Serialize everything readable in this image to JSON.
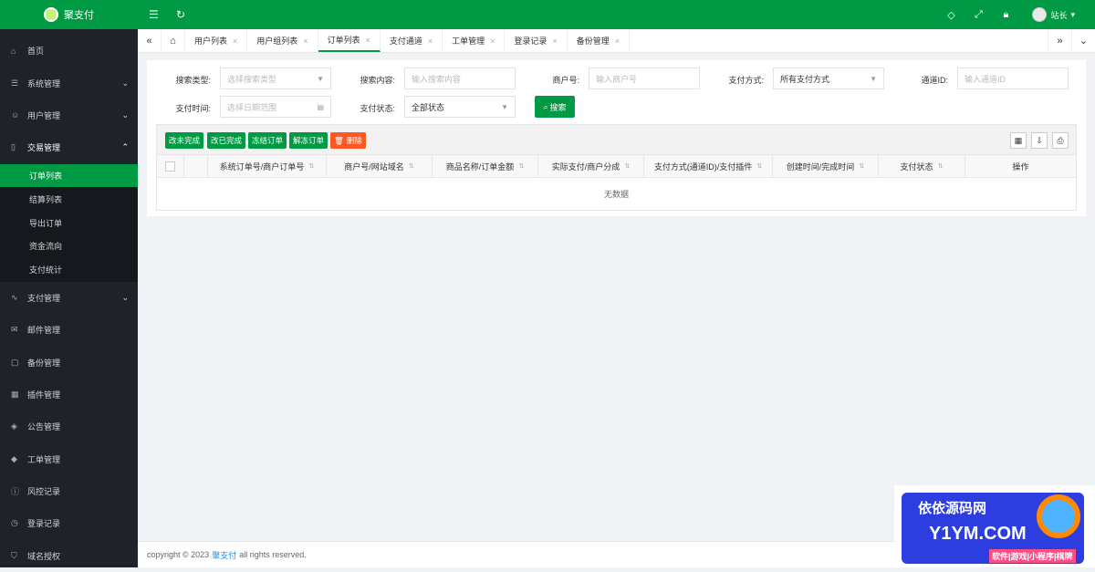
{
  "app": {
    "name": "聚支付",
    "user": "站长"
  },
  "topbar": {
    "collapse_icon": "menu-fold-icon",
    "refresh_icon": "refresh-icon",
    "right_icons": [
      "tag-icon",
      "fullscreen-icon",
      "lock-icon"
    ]
  },
  "sidebar": {
    "items": [
      {
        "label": "首页",
        "icon": "home-icon"
      },
      {
        "label": "系统管理",
        "icon": "sliders-icon"
      },
      {
        "label": "用户管理",
        "icon": "user-icon"
      },
      {
        "label": "交易管理",
        "icon": "document-icon"
      },
      {
        "label": "支付管理",
        "icon": "pulse-icon"
      },
      {
        "label": "邮件管理",
        "icon": "mail-icon"
      },
      {
        "label": "备份管理",
        "icon": "note-icon"
      },
      {
        "label": "插件管理",
        "icon": "grid-icon"
      },
      {
        "label": "公告管理",
        "icon": "megaphone-icon"
      },
      {
        "label": "工单管理",
        "icon": "ticket-icon"
      },
      {
        "label": "风控记录",
        "icon": "info-icon"
      },
      {
        "label": "登录记录",
        "icon": "clock-icon"
      },
      {
        "label": "域名授权",
        "icon": "shield-icon"
      }
    ],
    "sub_items": [
      "订单列表",
      "结算列表",
      "导出订单",
      "资金流向",
      "支付统计"
    ]
  },
  "tabs": [
    "用户列表",
    "用户组列表",
    "订单列表",
    "支付通道",
    "工单管理",
    "登录记录",
    "备份管理"
  ],
  "search": {
    "type_label": "搜索类型:",
    "type_placeholder": "选择搜索类型",
    "content_label": "搜索内容:",
    "content_placeholder": "输入搜索内容",
    "merchant_label": "商户号:",
    "merchant_placeholder": "输入商户号",
    "paytype_label": "支付方式:",
    "paytype_value": "所有支付方式",
    "channel_label": "通道ID:",
    "channel_placeholder": "输入通道ID",
    "time_label": "支付时间:",
    "time_placeholder": "选择日期范围",
    "status_label": "支付状态:",
    "status_value": "全部状态",
    "search_button": "搜索"
  },
  "toolbar": {
    "buttons": [
      "改未完成",
      "改已完成",
      "冻结订单",
      "解冻订单",
      "删除"
    ]
  },
  "table": {
    "columns": [
      "系统订单号/商户订单号",
      "商户号/网站域名",
      "商品名称/订单金额",
      "实际支付/商户分成",
      "支付方式(通道ID)/支付插件",
      "创建时间/完成时间",
      "支付状态",
      "操作"
    ],
    "empty_text": "无数据"
  },
  "footer": {
    "prefix": "copyright © 2023",
    "link": "聚支付",
    "suffix": "all rights reserved."
  },
  "watermark": {
    "line1": "依依源码网",
    "line2": "Y1YM.COM",
    "line3": "软件|游戏|小程序|棋牌"
  }
}
